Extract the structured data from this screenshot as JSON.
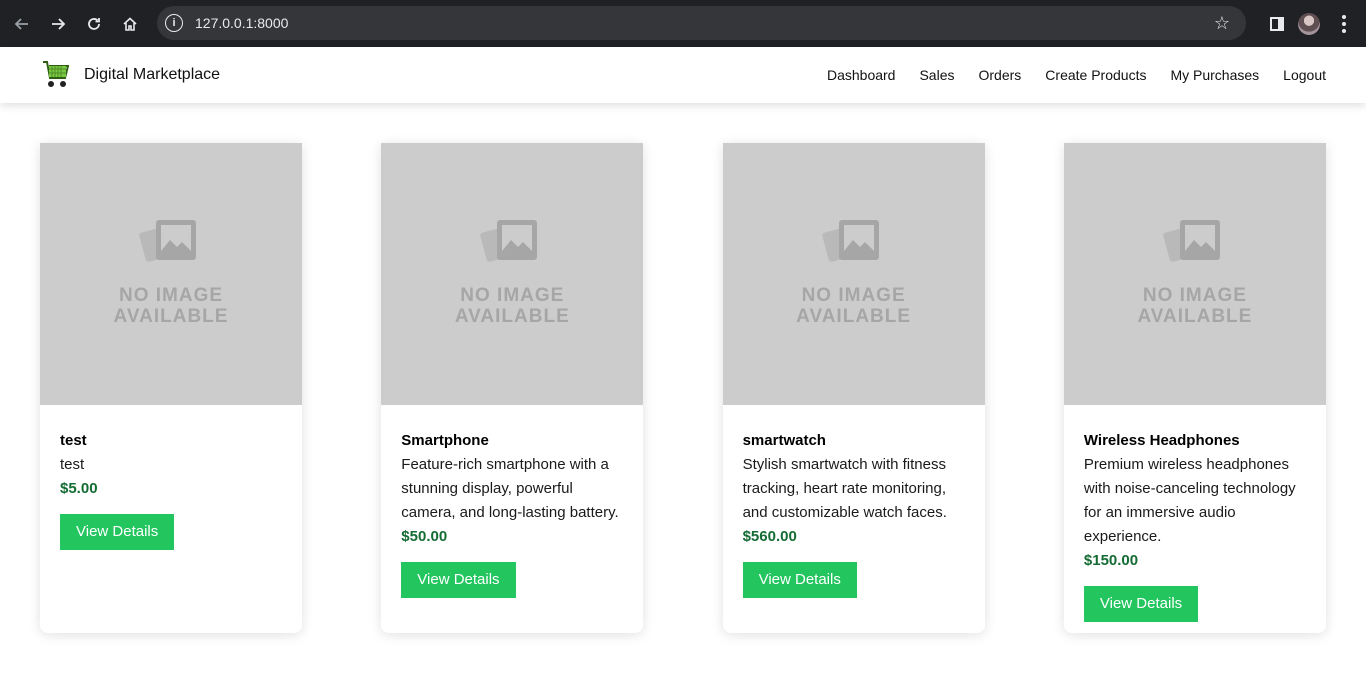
{
  "browser": {
    "url": "127.0.0.1:8000",
    "info_icon": "info-icon",
    "icons": [
      "back-icon",
      "forward-icon",
      "reload-icon",
      "home-icon",
      "star-icon",
      "side-panel-icon",
      "profile-avatar",
      "menu-icon"
    ]
  },
  "navbar": {
    "brand": "Digital Marketplace",
    "logo_icon": "shopping-cart-icon",
    "links": [
      "Dashboard",
      "Sales",
      "Orders",
      "Create Products",
      "My Purchases",
      "Logout"
    ]
  },
  "placeholder": {
    "line1": "NO IMAGE",
    "line2": "AVAILABLE"
  },
  "products": [
    {
      "name": "test",
      "description": "test",
      "price": "$5.00",
      "button": "View Details"
    },
    {
      "name": "Smartphone",
      "description": "Feature-rich smartphone with a stunning display, powerful camera, and long-lasting battery.",
      "price": "$50.00",
      "button": "View Details"
    },
    {
      "name": "smartwatch",
      "description": "Stylish smartwatch with fitness tracking, heart rate monitoring, and customizable watch faces.",
      "price": "$560.00",
      "button": "View Details"
    },
    {
      "name": "Wireless Headphones",
      "description": "Premium wireless headphones with noise-canceling technology for an immersive audio experience.",
      "price": "$150.00",
      "button": "View Details"
    }
  ],
  "colors": {
    "button": "#22c55e",
    "price": "#146c34",
    "placeholder_bg": "#cccccc"
  }
}
